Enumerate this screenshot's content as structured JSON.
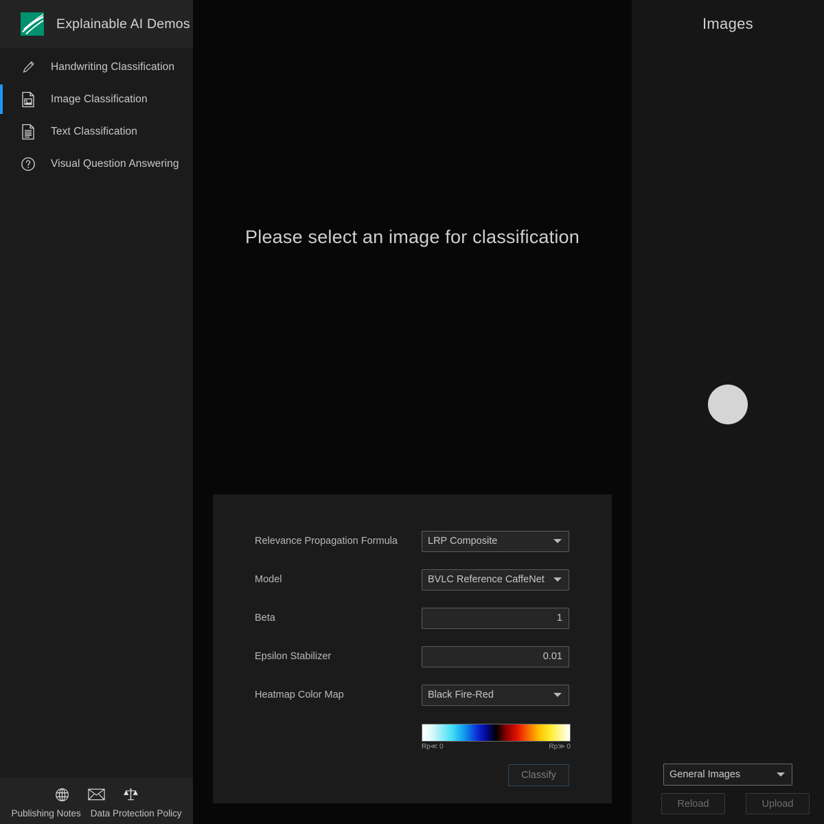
{
  "sidebar": {
    "app_title": "Explainable AI Demos",
    "logo_color": "#00916e",
    "active_accent": "#2196f3",
    "items": [
      {
        "label": "Handwriting Classification",
        "icon": "pencil-icon",
        "active": false
      },
      {
        "label": "Image Classification",
        "icon": "image-document-icon",
        "active": true
      },
      {
        "label": "Text Classification",
        "icon": "text-document-icon",
        "active": false
      },
      {
        "label": "Visual Question Answering",
        "icon": "question-circle-icon",
        "active": false
      }
    ],
    "footer": {
      "icons": [
        "globe-icon",
        "envelope-icon",
        "scales-icon"
      ],
      "links": [
        {
          "label": "Publishing Notes"
        },
        {
          "label": "Data Protection Policy"
        }
      ]
    }
  },
  "main": {
    "message": "Please select an image for classification",
    "settings": {
      "rows": [
        {
          "label": "Relevance Propagation Formula",
          "value": "LRP Composite",
          "type": "select"
        },
        {
          "label": "Model",
          "value": "BVLC Reference CaffeNet",
          "type": "select"
        },
        {
          "label": "Beta",
          "value": "1",
          "type": "number"
        },
        {
          "label": "Epsilon Stabilizer",
          "value": "0.01",
          "type": "number"
        },
        {
          "label": "Heatmap Color Map",
          "value": "Black Fire-Red",
          "type": "select"
        }
      ],
      "colorbar": {
        "left_label": "Rp≪ 0",
        "right_label": "Rp≫ 0",
        "stops": [
          "#ffffff",
          "#45dff5",
          "#0a2fd8",
          "#000000",
          "#e01000",
          "#ffc000",
          "#ffffff"
        ]
      },
      "classify_label": "Classify"
    }
  },
  "images": {
    "title": "Images",
    "category_value": "General Images",
    "reload_label": "Reload",
    "upload_label": "Upload"
  }
}
